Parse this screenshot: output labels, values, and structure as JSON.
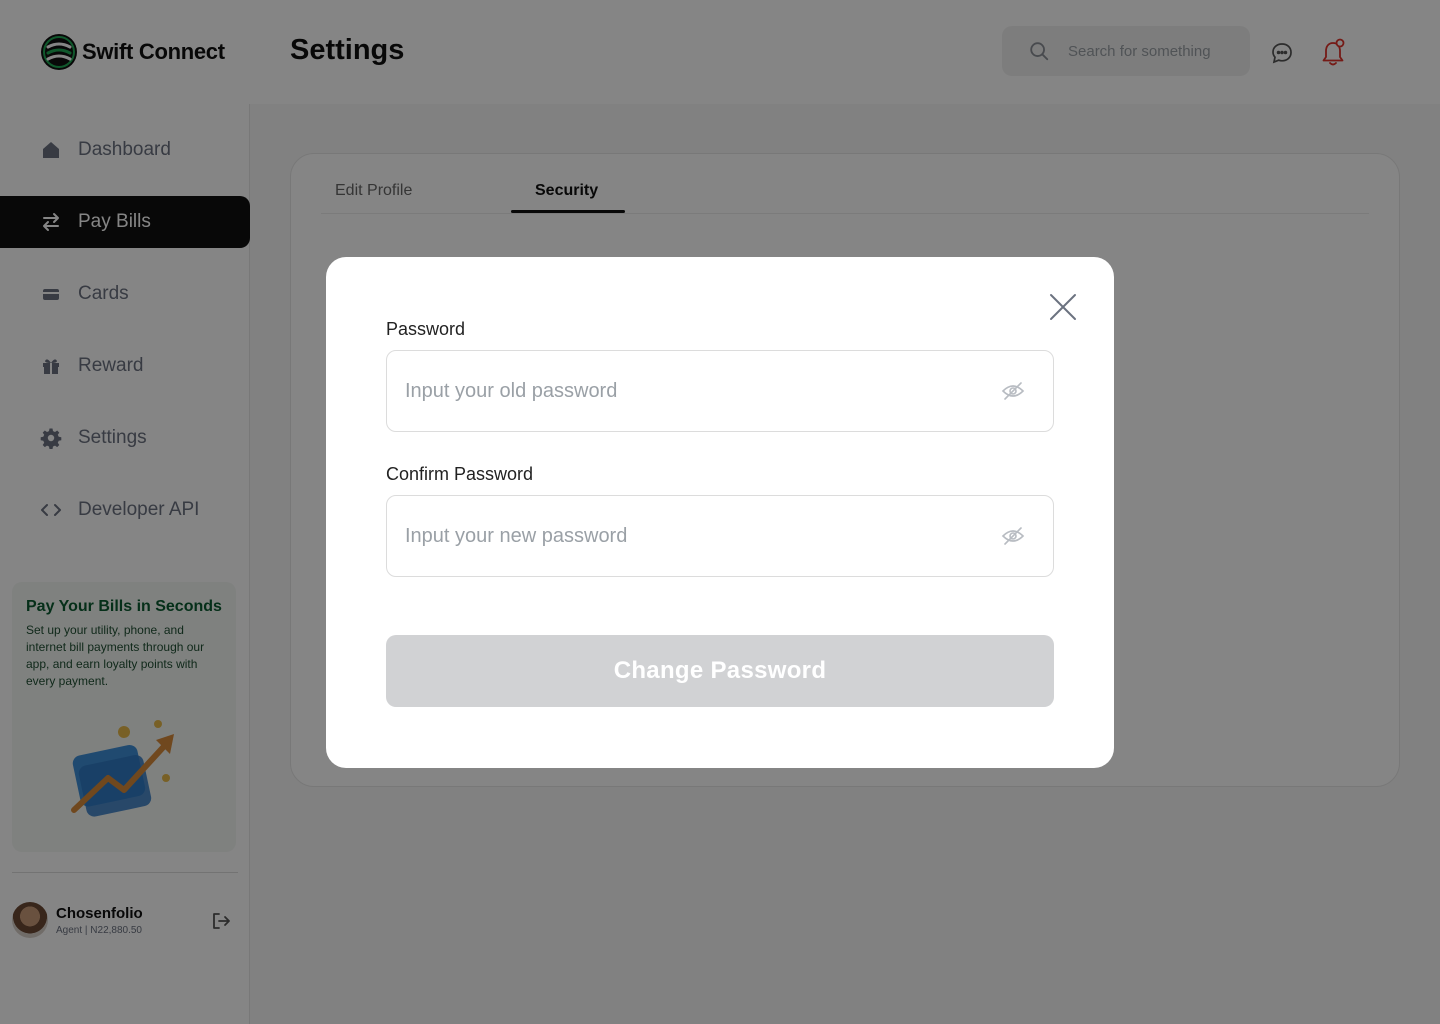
{
  "app": {
    "name": "Swift Connect"
  },
  "header": {
    "title": "Settings",
    "search_placeholder": "Search for something"
  },
  "sidebar": {
    "items": [
      {
        "label": "Dashboard",
        "icon": "home-icon",
        "active": false
      },
      {
        "label": "Pay Bills",
        "icon": "transfer-icon",
        "active": true
      },
      {
        "label": "Cards",
        "icon": "card-icon",
        "active": false
      },
      {
        "label": "Reward",
        "icon": "gift-icon",
        "active": false
      },
      {
        "label": "Settings",
        "icon": "gear-icon",
        "active": false
      },
      {
        "label": "Developer API",
        "icon": "code-icon",
        "active": false
      }
    ],
    "promo": {
      "title": "Pay Your Bills in Seconds",
      "text": "Set up your utility, phone, and internet bill payments through our app, and earn loyalty points with every payment."
    },
    "user": {
      "name": "Chosenfolio",
      "meta": "Agent | N22,880.50"
    }
  },
  "tabs": [
    {
      "label": "Edit Profile",
      "active": false
    },
    {
      "label": "Security",
      "active": true
    }
  ],
  "modal": {
    "password_label": "Password",
    "password_placeholder": "Input your old password",
    "confirm_label": "Confirm Password",
    "confirm_placeholder": "Input your new password",
    "submit_label": "Change Password"
  },
  "colors": {
    "brand_green": "#0b5b30",
    "active_nav": "#111111",
    "disabled_button": "#d1d2d4",
    "notification_red": "#e0322b"
  }
}
